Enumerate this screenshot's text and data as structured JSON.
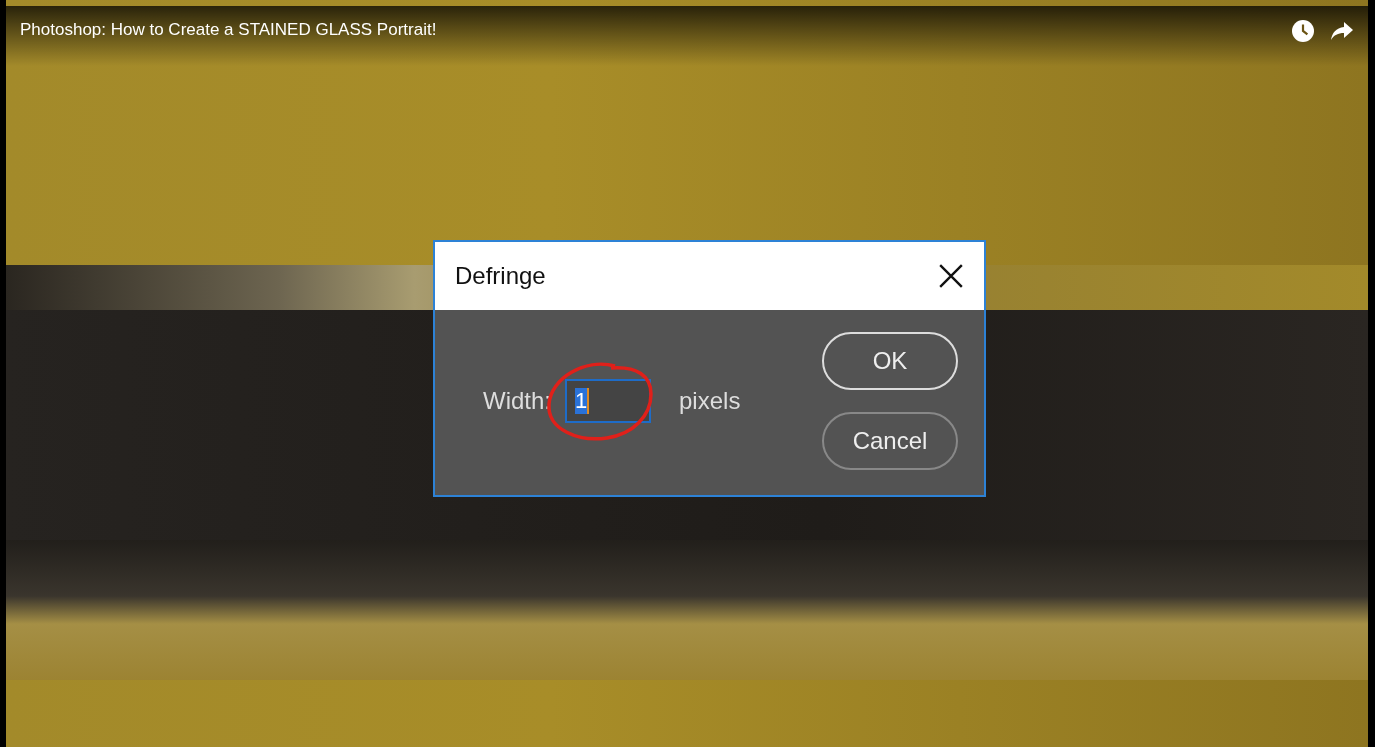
{
  "video": {
    "title": "Photoshop: How to Create a STAINED GLASS Portrait!"
  },
  "dialog": {
    "title": "Defringe",
    "field_label": "Width:",
    "field_value": "1",
    "unit": "pixels",
    "buttons": [
      {
        "label": "OK",
        "kind": "default"
      },
      {
        "label": "Cancel",
        "kind": "normal"
      }
    ]
  }
}
